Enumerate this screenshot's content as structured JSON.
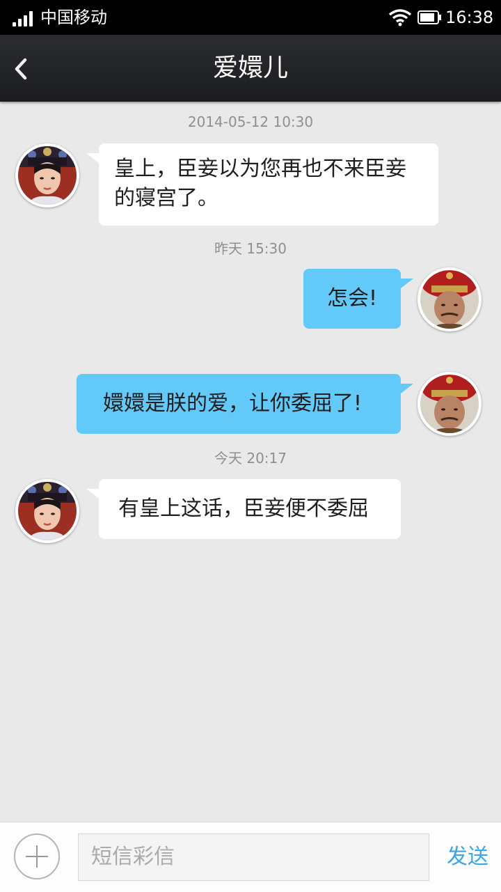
{
  "status_bar": {
    "carrier": "中国移动",
    "time": "16:38",
    "icons": [
      "signal-icon",
      "wifi-icon",
      "battery-icon"
    ]
  },
  "header": {
    "title": "爱嬛儿",
    "back_icon": "chevron-left-icon"
  },
  "messages": [
    {
      "timestamp": "2014-05-12  10:30",
      "sender": "contact",
      "lines": [
        "皇上，臣妾以为您再也不来臣妾",
        "的寝宫了。"
      ]
    },
    {
      "timestamp": "昨天  15:30",
      "sender": "me",
      "lines": [
        "怎会!"
      ]
    },
    {
      "timestamp": "",
      "sender": "me",
      "lines": [
        "嬛嬛是朕的爱，让你委屈了!"
      ]
    },
    {
      "timestamp": "今天  20:17",
      "sender": "contact",
      "lines": [
        "有皇上这话，臣妾便不委屈"
      ]
    }
  ],
  "input_bar": {
    "add_icon": "plus-icon",
    "placeholder": "短信彩信",
    "send_label": "发送"
  },
  "colors": {
    "incoming_bubble": "#ffffff",
    "outgoing_bubble": "#62c9f9",
    "send_text": "#3aa6e6",
    "background": "#e9e9e9"
  }
}
